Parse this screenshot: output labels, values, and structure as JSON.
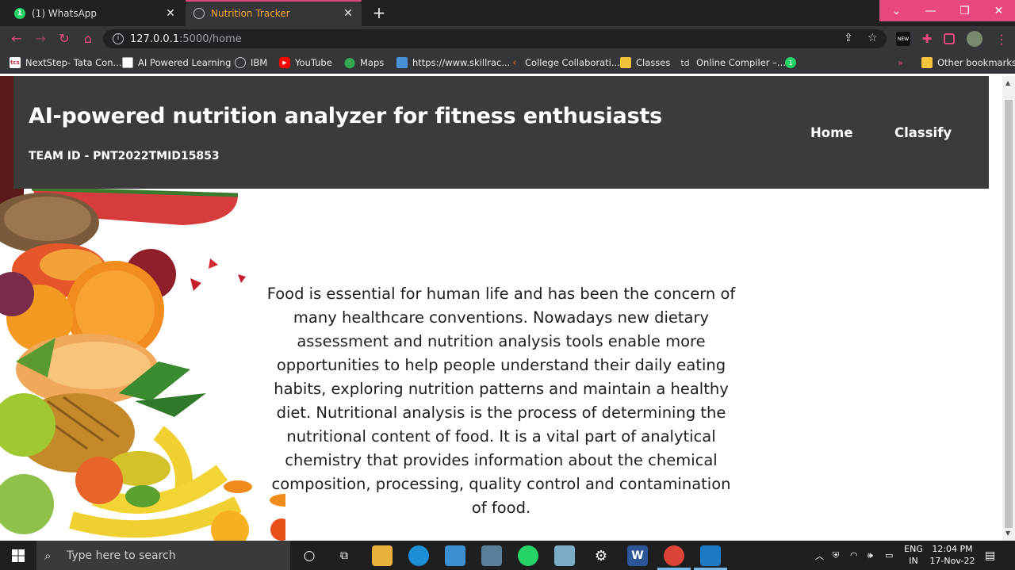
{
  "browser": {
    "tabs": [
      {
        "label": "(1) WhatsApp",
        "badge": "1",
        "active": false
      },
      {
        "label": "Nutrition Tracker",
        "active": true
      }
    ],
    "address": {
      "host": "127.0.0.1",
      "path": ":5000/home"
    },
    "ext_badge": "NEW",
    "bookmarks": [
      {
        "label": "NextStep- Tata Con...",
        "icon": "tcs-icon"
      },
      {
        "label": "AI Powered Learning",
        "icon": "page-icon"
      },
      {
        "label": "IBM",
        "icon": "globe-icon"
      },
      {
        "label": "YouTube",
        "icon": "youtube-icon"
      },
      {
        "label": "Maps",
        "icon": "maps-pin-icon"
      },
      {
        "label": "https://www.skillrac...",
        "icon": "skillrack-icon"
      },
      {
        "label": "College Collaborati...",
        "icon": "college-icon"
      },
      {
        "label": "Classes",
        "icon": "classroom-icon"
      },
      {
        "label": "Online Compiler –...",
        "icon": "td-icon",
        "prefix": "td"
      },
      {
        "label": "",
        "icon": "whatsapp-icon",
        "badge": "1"
      }
    ],
    "other_bookmarks": "Other bookmarks",
    "overflow": "»"
  },
  "header": {
    "title": "AI-powered nutrition analyzer for fitness enthusiasts",
    "team_id": "TEAM ID - PNT2022TMID15853",
    "nav": [
      {
        "label": "Home"
      },
      {
        "label": "Classify"
      }
    ]
  },
  "main": {
    "description": "Food is essential for human life and has been the concern of many healthcare conventions. Nowadays new dietary assessment and nutrition analysis tools enable more opportunities to help people understand their daily eating habits, exploring nutrition patterns and maintain a healthy diet. Nutritional analysis is the process of determining the nutritional content of food. It is a vital part of analytical chemistry that provides information about the chemical composition, processing, quality control and contamination of food."
  },
  "taskbar": {
    "search_placeholder": "Type here to search",
    "lang_line1": "ENG",
    "lang_line2": "IN",
    "time": "12:04 PM",
    "date": "17-Nov-22"
  },
  "colors": {
    "accent": "#e8487f",
    "banner_bg": "#3b3b3b",
    "chrome_dark": "#202124",
    "chrome_toolbar": "#35363a",
    "text": "#1e1e1e"
  }
}
